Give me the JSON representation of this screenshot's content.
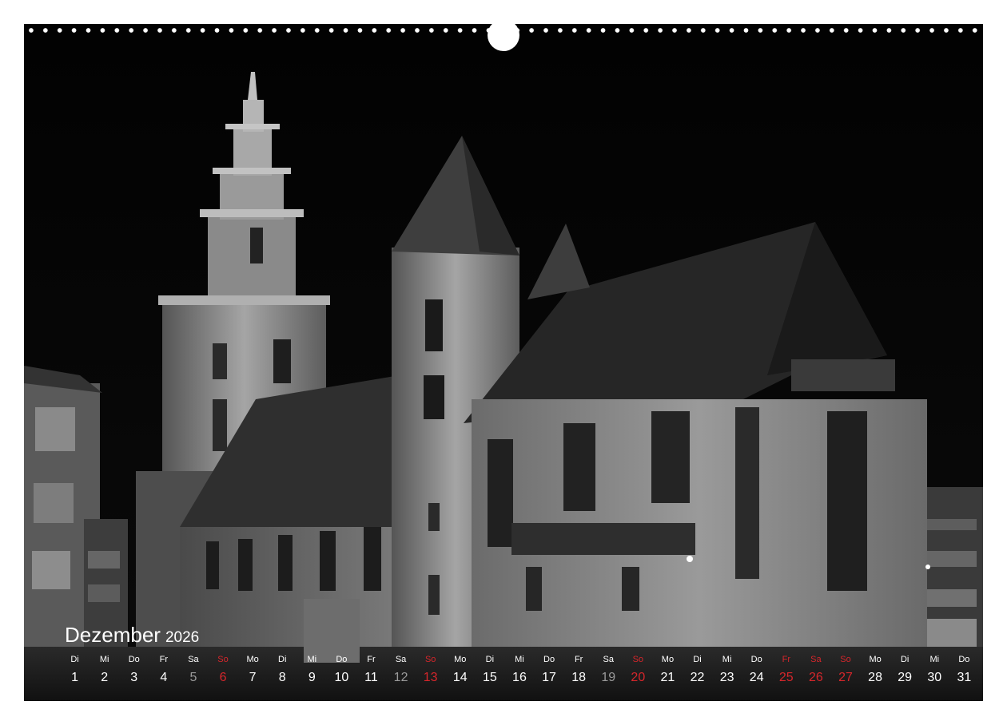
{
  "calendar": {
    "month": "Dezember",
    "year": "2026",
    "sunday_color": "#d6262b",
    "holiday_color": "#d6262b",
    "day_names": [
      "Di",
      "Mi",
      "Do",
      "Fr",
      "Sa",
      "So",
      "Mo",
      "Di",
      "Mi",
      "Do",
      "Fr",
      "Sa",
      "So",
      "Mo",
      "Di",
      "Mi",
      "Do",
      "Fr",
      "Sa",
      "So",
      "Mo",
      "Di",
      "Mi",
      "Do",
      "Fr",
      "Sa",
      "So",
      "Mo",
      "Di",
      "Mi",
      "Do"
    ],
    "day_numbers": [
      "1",
      "2",
      "3",
      "4",
      "5",
      "6",
      "7",
      "8",
      "9",
      "10",
      "11",
      "12",
      "13",
      "14",
      "15",
      "16",
      "17",
      "18",
      "19",
      "20",
      "21",
      "22",
      "23",
      "24",
      "25",
      "26",
      "27",
      "28",
      "29",
      "30",
      "31"
    ],
    "red_days": [
      "6",
      "13",
      "20",
      "25",
      "26",
      "27"
    ],
    "dim_days": [
      "5",
      "12",
      "19"
    ]
  },
  "photo": {
    "subject": "church-night",
    "tone": "black-and-white"
  }
}
